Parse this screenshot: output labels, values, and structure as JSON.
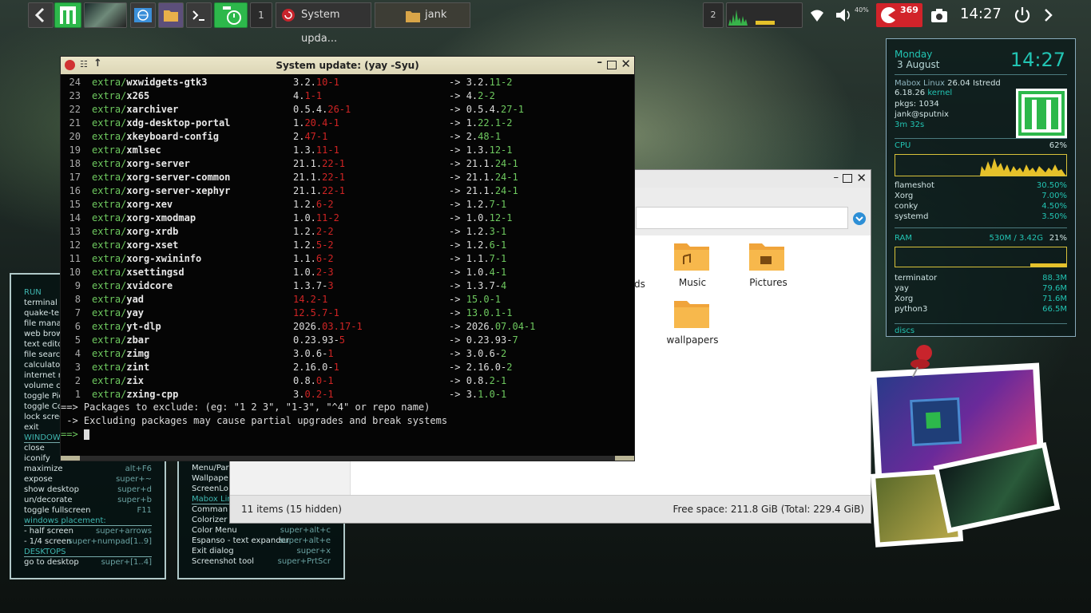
{
  "panel": {
    "workspace_number": "1",
    "tasks": [
      {
        "label": "System upda..."
      },
      {
        "label": "jank"
      }
    ],
    "cpu_count": "2",
    "volume": "40%",
    "notifications": "369",
    "clock": "14:27"
  },
  "terminal": {
    "title": "System update: (yay -Syu)",
    "packages": [
      {
        "n": "24",
        "repo": "extra/",
        "name": "wxwidgets-gtk3",
        "old_a": "3.2.",
        "old_b": "10-1",
        "new_a": "3.2.",
        "new_b": "11-2"
      },
      {
        "n": "23",
        "repo": "extra/",
        "name": "x265",
        "old_a": "4.",
        "old_b": "1-1",
        "new_a": "4.",
        "new_b": "2-2"
      },
      {
        "n": "22",
        "repo": "extra/",
        "name": "xarchiver",
        "old_a": "0.5.4.",
        "old_b": "26-1",
        "new_a": "0.5.4.",
        "new_b": "27-1"
      },
      {
        "n": "21",
        "repo": "extra/",
        "name": "xdg-desktop-portal",
        "old_a": "1.",
        "old_b": "20.4-1",
        "new_a": "1.",
        "new_b": "22.1-2"
      },
      {
        "n": "20",
        "repo": "extra/",
        "name": "xkeyboard-config",
        "old_a": "2.",
        "old_b": "47-1",
        "new_a": "2.",
        "new_b": "48-1"
      },
      {
        "n": "19",
        "repo": "extra/",
        "name": "xmlsec",
        "old_a": "1.3.",
        "old_b": "11-1",
        "new_a": "1.3.",
        "new_b": "12-1"
      },
      {
        "n": "18",
        "repo": "extra/",
        "name": "xorg-server",
        "old_a": "21.1.",
        "old_b": "22-1",
        "new_a": "21.1.",
        "new_b": "24-1"
      },
      {
        "n": "17",
        "repo": "extra/",
        "name": "xorg-server-common",
        "old_a": "21.1.",
        "old_b": "22-1",
        "new_a": "21.1.",
        "new_b": "24-1"
      },
      {
        "n": "16",
        "repo": "extra/",
        "name": "xorg-server-xephyr",
        "old_a": "21.1.",
        "old_b": "22-1",
        "new_a": "21.1.",
        "new_b": "24-1"
      },
      {
        "n": "15",
        "repo": "extra/",
        "name": "xorg-xev",
        "old_a": "1.2.",
        "old_b": "6-2",
        "new_a": "1.2.",
        "new_b": "7-1"
      },
      {
        "n": "14",
        "repo": "extra/",
        "name": "xorg-xmodmap",
        "old_a": "1.0.",
        "old_b": "11-2",
        "new_a": "1.0.",
        "new_b": "12-1"
      },
      {
        "n": "13",
        "repo": "extra/",
        "name": "xorg-xrdb",
        "old_a": "1.2.",
        "old_b": "2-2",
        "new_a": "1.2.",
        "new_b": "3-1"
      },
      {
        "n": "12",
        "repo": "extra/",
        "name": "xorg-xset",
        "old_a": "1.2.",
        "old_b": "5-2",
        "new_a": "1.2.",
        "new_b": "6-1"
      },
      {
        "n": "11",
        "repo": "extra/",
        "name": "xorg-xwininfo",
        "old_a": "1.1.",
        "old_b": "6-2",
        "new_a": "1.1.",
        "new_b": "7-1"
      },
      {
        "n": "10",
        "repo": "extra/",
        "name": "xsettingsd",
        "old_a": "1.0.",
        "old_b": "2-3",
        "new_a": "1.0.",
        "new_b": "4-1"
      },
      {
        "n": "9",
        "repo": "extra/",
        "name": "xvidcore",
        "old_a": "1.3.7-",
        "old_b": "3",
        "new_a": "1.3.7-",
        "new_b": "4"
      },
      {
        "n": "8",
        "repo": "extra/",
        "name": "yad",
        "old_a": "",
        "old_b": "14.2-1",
        "new_a": "",
        "new_b": "15.0-1"
      },
      {
        "n": "7",
        "repo": "extra/",
        "name": "yay",
        "old_a": "",
        "old_b": "12.5.7-1",
        "new_a": "",
        "new_b": "13.0.1-1"
      },
      {
        "n": "6",
        "repo": "extra/",
        "name": "yt-dlp",
        "old_a": "2026.",
        "old_b": "03.17-1",
        "new_a": "2026.",
        "new_b": "07.04-1"
      },
      {
        "n": "5",
        "repo": "extra/",
        "name": "zbar",
        "old_a": "0.23.93-",
        "old_b": "5",
        "new_a": "0.23.93-",
        "new_b": "7"
      },
      {
        "n": "4",
        "repo": "extra/",
        "name": "zimg",
        "old_a": "3.0.6-",
        "old_b": "1",
        "new_a": "3.0.6-",
        "new_b": "2"
      },
      {
        "n": "3",
        "repo": "extra/",
        "name": "zint",
        "old_a": "2.16.0-",
        "old_b": "1",
        "new_a": "2.16.0-",
        "new_b": "2"
      },
      {
        "n": "2",
        "repo": "extra/",
        "name": "zix",
        "old_a": "0.8.",
        "old_b": "0-1",
        "new_a": "0.8.",
        "new_b": "2-1"
      },
      {
        "n": "1",
        "repo": "extra/",
        "name": "zxing-cpp",
        "old_a": "3.",
        "old_b": "0.2-1",
        "new_a": "3.",
        "new_b": "1.0-1"
      }
    ],
    "arrow": "->",
    "prompt_line": "==> Packages to exclude: (eg: \"1 2 3\", \"1-3\", \"^4\" or repo name)",
    "warning_line": " -> Excluding packages may cause partial upgrades and break systems",
    "input_prompt": "==>"
  },
  "files": {
    "folders": [
      {
        "label": "Music"
      },
      {
        "label": "Pictures"
      },
      {
        "label": "wallpapers"
      }
    ],
    "partial_label": "ds",
    "status_left": "11 items (15 hidden)",
    "status_right": "Free space: 211.8 GiB (Total: 229.4 GiB)"
  },
  "conky": {
    "day": "Monday",
    "date": "3 August",
    "time": "14:27",
    "distro": "Mabox Linux",
    "distro_ver": "26.04 Istredd",
    "kernel_ver": "6.18.26",
    "kernel_label": "kernel",
    "pkgs": "pkgs: 1034",
    "user": "jank@sputnix",
    "uptime": "3m 32s",
    "cpu_label": "CPU",
    "cpu_pct": "62%",
    "cpu_procs": [
      {
        "name": "flameshot",
        "val": "30.50%"
      },
      {
        "name": "Xorg",
        "val": "7.00%"
      },
      {
        "name": "conky",
        "val": "4.50%"
      },
      {
        "name": "systemd",
        "val": "3.50%"
      }
    ],
    "ram_label": "RAM",
    "ram_used": "530M / 3.42G",
    "ram_pct": "21%",
    "ram_fill": 0.21,
    "ram_procs": [
      {
        "name": "terminator",
        "val": "88.3M"
      },
      {
        "name": "yay",
        "val": "79.6M"
      },
      {
        "name": "Xorg",
        "val": "71.6M"
      },
      {
        "name": "python3",
        "val": "66.5M"
      }
    ],
    "discs_label": "discs"
  },
  "help_left": {
    "lines": [
      {
        "t": "RUN",
        "k": "",
        "sec": true
      },
      {
        "t": "terminal",
        "k": ""
      },
      {
        "t": "quake-ter",
        "k": ""
      },
      {
        "t": "file mana",
        "k": ""
      },
      {
        "t": "web brow",
        "k": ""
      },
      {
        "t": "text edito",
        "k": ""
      },
      {
        "t": "file searc",
        "k": ""
      },
      {
        "t": "calculato",
        "k": ""
      },
      {
        "t": "internet r",
        "k": ""
      },
      {
        "t": "volume co",
        "k": ""
      },
      {
        "t": "toggle Pic",
        "k": ""
      },
      {
        "t": "toggle Co",
        "k": ""
      },
      {
        "t": "lock scree",
        "k": ""
      },
      {
        "t": "exit",
        "k": ""
      },
      {
        "t": "WINDOW",
        "k": "",
        "sec": true
      },
      {
        "t": "close",
        "k": ""
      },
      {
        "t": "iconify",
        "k": ""
      },
      {
        "t": "maximize",
        "k": "alt+F6"
      },
      {
        "t": "expose",
        "k": "super+~"
      },
      {
        "t": "show desktop",
        "k": "super+d"
      },
      {
        "t": "un/decorate",
        "k": "super+b"
      },
      {
        "t": "toggle fullscreen",
        "k": "F11"
      },
      {
        "t": "windows placement:",
        "k": "",
        "sec": true
      },
      {
        "t": " - half screen",
        "k": "super+arrows"
      },
      {
        "t": " - 1/4 screen",
        "k": "super+numpad[1..9]"
      },
      {
        "t": "DESKTOPS",
        "k": "",
        "sec": true
      },
      {
        "t": "go to desktop",
        "k": "super+[1..4]"
      }
    ]
  },
  "help_right": {
    "lines": [
      {
        "t": "Menu/Par",
        "k": ""
      },
      {
        "t": "Wallpape",
        "k": ""
      },
      {
        "t": "ScreenLo",
        "k": ""
      },
      {
        "t": "Mabox Lin",
        "k": "",
        "sec": true
      },
      {
        "t": "Comman",
        "k": ""
      },
      {
        "t": "Colorizer",
        "k": ""
      },
      {
        "t": "Color Menu",
        "k": "super+alt+c"
      },
      {
        "t": "Espanso - text expander",
        "k": "super+alt+e"
      },
      {
        "t": "Exit dialog",
        "k": "super+x"
      },
      {
        "t": "Screenshot tool",
        "k": "super+PrtScr"
      }
    ]
  },
  "colors": {
    "accent_teal": "#22c4b3",
    "mabox_green": "#2db84b",
    "graph_yellow": "#e5c12a",
    "version_red": "#d02424",
    "version_green": "#6ec95f"
  },
  "icons": [
    "back-arrow-icon",
    "mabox-logo-icon",
    "wallpaper-thumb-icon",
    "browser-icon",
    "folder-icon",
    "terminal-icon",
    "clock-app-icon",
    "wifi-icon",
    "volume-icon",
    "update-icon",
    "camera-icon",
    "power-icon",
    "chevron-right-icon",
    "close-icon",
    "maximize-icon",
    "minimize-icon",
    "pin-icon",
    "download-icon"
  ]
}
